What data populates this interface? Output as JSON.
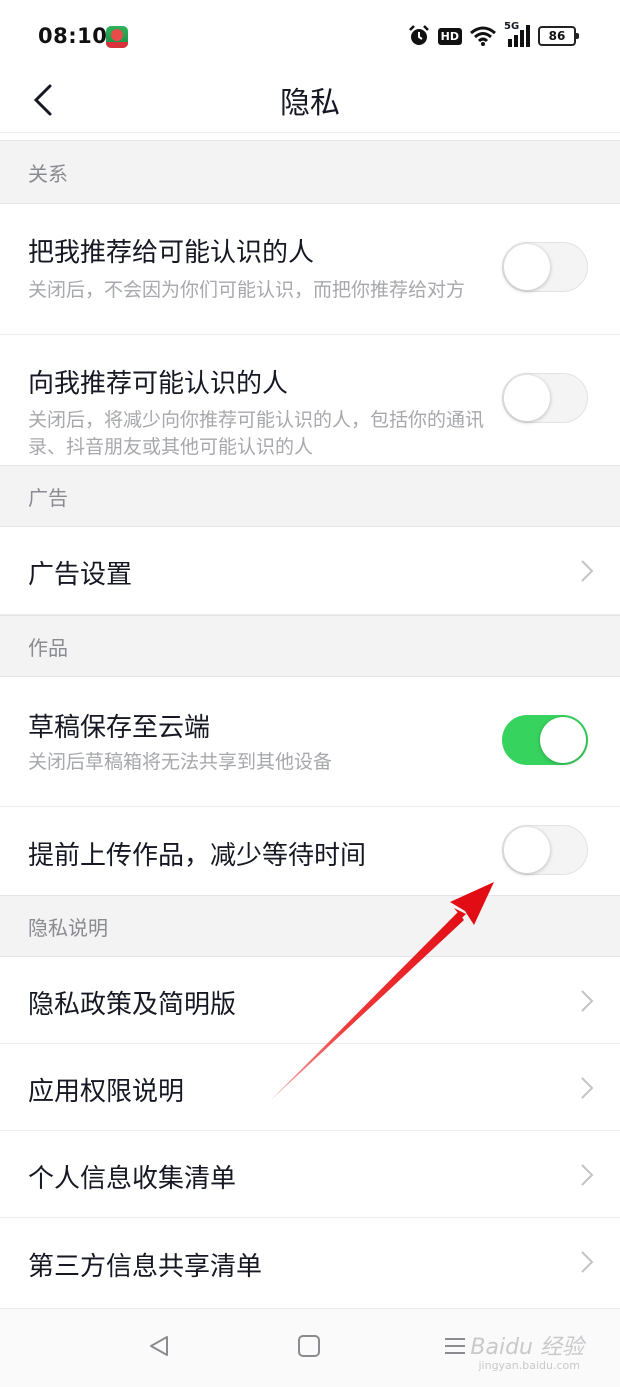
{
  "status_bar": {
    "time": "08:10",
    "hd_label": "HD",
    "network": "5G",
    "battery": "86"
  },
  "header": {
    "title": "隐私",
    "back_icon": "chevron-left-icon"
  },
  "sections": {
    "relations": {
      "header": "关系",
      "recommend_me": {
        "title": "把我推荐给可能认识的人",
        "desc": "关闭后，不会因为你们可能认识，而把你推荐给对方",
        "enabled": false
      },
      "recommend_to_me": {
        "title": "向我推荐可能认识的人",
        "desc": "关闭后，将减少向你推荐可能认识的人，包括你的通讯录、抖音朋友或其他可能认识的人",
        "enabled": false
      }
    },
    "ads": {
      "header": "广告",
      "ad_settings": {
        "title": "广告设置"
      }
    },
    "works": {
      "header": "作品",
      "draft_cloud": {
        "title": "草稿保存至云端",
        "desc": "关闭后草稿箱将无法共享到其他设备",
        "enabled": true
      },
      "pre_upload": {
        "title": "提前上传作品，减少等待时间",
        "enabled": false
      }
    },
    "privacy_info": {
      "header": "隐私说明",
      "items": [
        {
          "title": "隐私政策及简明版"
        },
        {
          "title": "应用权限说明"
        },
        {
          "title": "个人信息收集清单"
        },
        {
          "title": "第三方信息共享清单"
        }
      ]
    }
  },
  "bottom_nav": {
    "watermark": "Baidu 经验",
    "watermark_sub": "jingyan.baidu.com"
  },
  "colors": {
    "toggle_on": "#36d45e",
    "annotation_arrow": "#e8141b"
  }
}
